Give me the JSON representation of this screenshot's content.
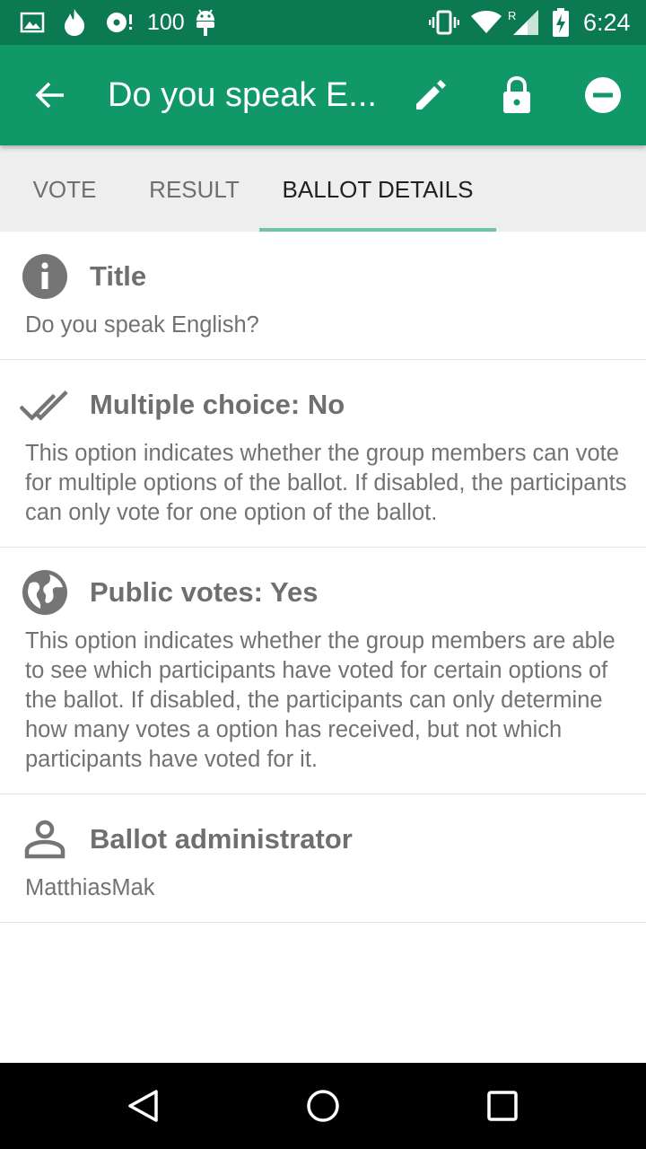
{
  "status_bar": {
    "battery_saver_text": "100",
    "time": "6:24",
    "roaming_indicator": "R",
    "icons": [
      "image-icon",
      "flame-icon",
      "disc-icon",
      "android-icon",
      "vibrate-icon",
      "wifi-icon",
      "signal-icon",
      "battery-charging-icon"
    ]
  },
  "app_bar": {
    "title": "Do you speak E...",
    "icons": [
      "back-arrow-icon",
      "edit-icon",
      "lock-icon",
      "remove-icon"
    ]
  },
  "tabs": [
    {
      "label": "VOTE",
      "active": false
    },
    {
      "label": "RESULT",
      "active": false
    },
    {
      "label": "BALLOT DETAILS",
      "active": true
    }
  ],
  "details": {
    "title": {
      "icon": "info-icon",
      "heading": "Title",
      "value": "Do you speak English?"
    },
    "multiple_choice": {
      "icon": "double-check-icon",
      "heading": "Multiple choice: No",
      "description": "This option indicates whether the group members can vote for multiple options of the ballot. If disabled, the participants can only vote for one option of the ballot."
    },
    "public_votes": {
      "icon": "globe-icon",
      "heading": "Public votes: Yes",
      "description": "This option indicates whether the group members are able to see which participants have voted for certain options of the ballot. If disabled, the participants can only determine how many votes a option has received, but not which participants have voted for it."
    },
    "administrator": {
      "icon": "person-icon",
      "heading": "Ballot administrator",
      "value": "MatthiasMak"
    }
  },
  "nav_bar": {
    "icons": [
      "back-triangle-icon",
      "home-circle-icon",
      "recents-square-icon"
    ]
  },
  "colors": {
    "status_bar": "#0b7a52",
    "app_bar": "#109869",
    "tab_indicator": "#6fc4a2",
    "tab_background": "#eeeeee",
    "section_text": "#727272"
  }
}
